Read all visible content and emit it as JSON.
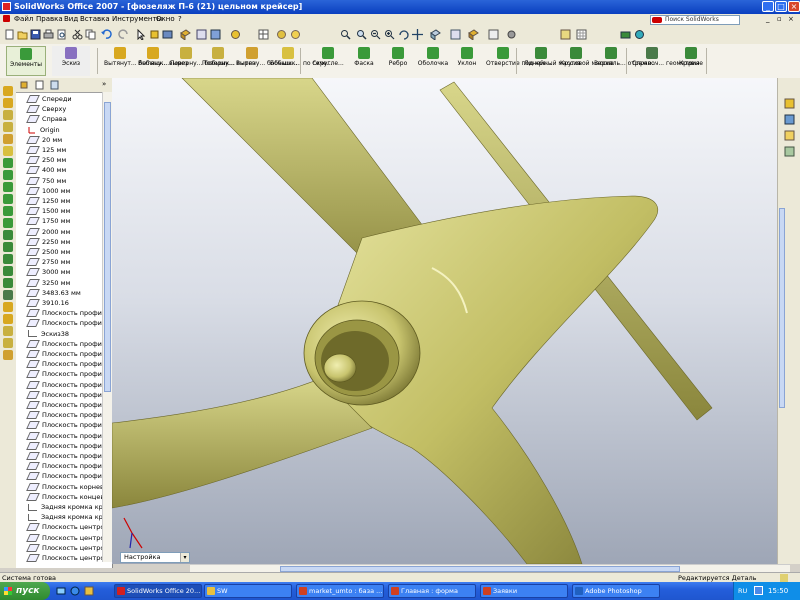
{
  "window": {
    "title": "SolidWorks Office 2007 - [фюзеляж П-6 (21) цельном крейсер]"
  },
  "menu": {
    "items": [
      "Файл",
      "Правка",
      "Вид",
      "Вставка",
      "Инструменты",
      "Окно",
      "?"
    ],
    "search_placeholder": "Поиск SolidWorks"
  },
  "command_manager": {
    "tabs": [
      {
        "label": "Элементы"
      },
      {
        "label": "Эскиз"
      }
    ],
    "buttons": [
      {
        "label": "Вытянут... бобышк...",
        "color": "#d8a820"
      },
      {
        "label": "Вытяну... вырез",
        "color": "#d8a820"
      },
      {
        "label": "Поверну... бобышк...",
        "color": "#c8b040"
      },
      {
        "label": "Поверну... вырез",
        "color": "#c8b040"
      },
      {
        "label": "Вытяну... бобышк...",
        "color": "#d0a030"
      },
      {
        "label": "Бобышк... по сече...",
        "color": "#d8c040"
      },
      {
        "label": "Скругле...",
        "color": "#3a9a3a"
      },
      {
        "label": "Фаска",
        "color": "#3a9a3a"
      },
      {
        "label": "Ребро",
        "color": "#3a9a3a"
      },
      {
        "label": "Оболочка",
        "color": "#3a9a3a"
      },
      {
        "label": "Уклон",
        "color": "#3a9a3a"
      },
      {
        "label": "Отверстие под кре...",
        "color": "#3a9a3a"
      },
      {
        "label": "Линейный массив",
        "color": "#3a8a3a"
      },
      {
        "label": "Круговой массив",
        "color": "#3a8a3a"
      },
      {
        "label": "Зеркаль... отраже...",
        "color": "#3a8a3a"
      },
      {
        "label": "Справоч... геометрия",
        "color": "#4a7a4a"
      },
      {
        "label": "Кривые",
        "color": "#3a8a3a"
      }
    ]
  },
  "feature_tree": {
    "items": [
      {
        "label": "Спереди",
        "kind": "plane"
      },
      {
        "label": "Сверху",
        "kind": "plane"
      },
      {
        "label": "Справа",
        "kind": "plane"
      },
      {
        "label": "Origin",
        "kind": "origin"
      },
      {
        "label": "20 мм",
        "kind": "plane"
      },
      {
        "label": "125 мм",
        "kind": "plane"
      },
      {
        "label": "250 мм",
        "kind": "plane"
      },
      {
        "label": "400 мм",
        "kind": "plane"
      },
      {
        "label": "750 мм",
        "kind": "plane"
      },
      {
        "label": "1000 мм",
        "kind": "plane"
      },
      {
        "label": "1250 мм",
        "kind": "plane"
      },
      {
        "label": "1500 мм",
        "kind": "plane"
      },
      {
        "label": "1750 мм",
        "kind": "plane"
      },
      {
        "label": "2000 мм",
        "kind": "plane"
      },
      {
        "label": "2250 мм",
        "kind": "plane"
      },
      {
        "label": "2500 мм",
        "kind": "plane"
      },
      {
        "label": "2750 мм",
        "kind": "plane"
      },
      {
        "label": "3000 мм",
        "kind": "plane"
      },
      {
        "label": "3250 мм",
        "kind": "plane"
      },
      {
        "label": "3483.63 мм",
        "kind": "plane"
      },
      {
        "label": "3910.16",
        "kind": "plane"
      },
      {
        "label": "Плоскость профиля",
        "kind": "plane"
      },
      {
        "label": "Плоскость профиля",
        "kind": "plane"
      },
      {
        "label": "Эскиз38",
        "kind": "sketch"
      },
      {
        "label": "Плоскость профиля",
        "kind": "plane"
      },
      {
        "label": "Плоскость профиля",
        "kind": "plane"
      },
      {
        "label": "Плоскость профиля",
        "kind": "plane"
      },
      {
        "label": "Плоскость профиля",
        "kind": "plane"
      },
      {
        "label": "Плоскость профиля",
        "kind": "plane"
      },
      {
        "label": "Плоскость профиля",
        "kind": "plane"
      },
      {
        "label": "Плоскость профиля",
        "kind": "plane"
      },
      {
        "label": "Плоскость профиля",
        "kind": "plane"
      },
      {
        "label": "Плоскость профиля",
        "kind": "plane"
      },
      {
        "label": "Плоскость профиля",
        "kind": "plane"
      },
      {
        "label": "Плоскость профиля",
        "kind": "plane"
      },
      {
        "label": "Плоскость профиля",
        "kind": "plane"
      },
      {
        "label": "Плоскость профиля",
        "kind": "plane"
      },
      {
        "label": "Плоскость профиля",
        "kind": "plane"
      },
      {
        "label": "Плоскость корнево",
        "kind": "plane"
      },
      {
        "label": "Плоскость концево",
        "kind": "plane"
      },
      {
        "label": "Задняя кромка крыл",
        "kind": "sketch"
      },
      {
        "label": "Задняя кромка крыл",
        "kind": "sketch"
      },
      {
        "label": "Плоскость центропл",
        "kind": "plane"
      },
      {
        "label": "Плоскость центропл",
        "kind": "plane"
      },
      {
        "label": "Плоскость центропл",
        "kind": "plane"
      },
      {
        "label": "Плоскость центропл",
        "kind": "plane"
      }
    ]
  },
  "configuration_tab": {
    "label": "Настройка"
  },
  "status_bar": {
    "left": "Система готова",
    "right": "Редактируется Деталь"
  },
  "taskbar": {
    "start_label": "пуск",
    "tasks": [
      {
        "label": "SolidWorks Office 20...",
        "color": "#d22020"
      },
      {
        "label": "SW",
        "color": "#e8c040"
      },
      {
        "label": "market_umto : база ...",
        "color": "#d04020"
      },
      {
        "label": "Главная : форма",
        "color": "#d04020"
      },
      {
        "label": "Заявки",
        "color": "#d04020"
      },
      {
        "label": "Adobe Photoshop",
        "color": "#2060c0"
      }
    ],
    "language": "RU",
    "clock": "15:50"
  },
  "model": {
    "body_color": "#c8c46e",
    "shadow_color": "#6e6a2a",
    "highlight_color": "#f0eeb0"
  }
}
